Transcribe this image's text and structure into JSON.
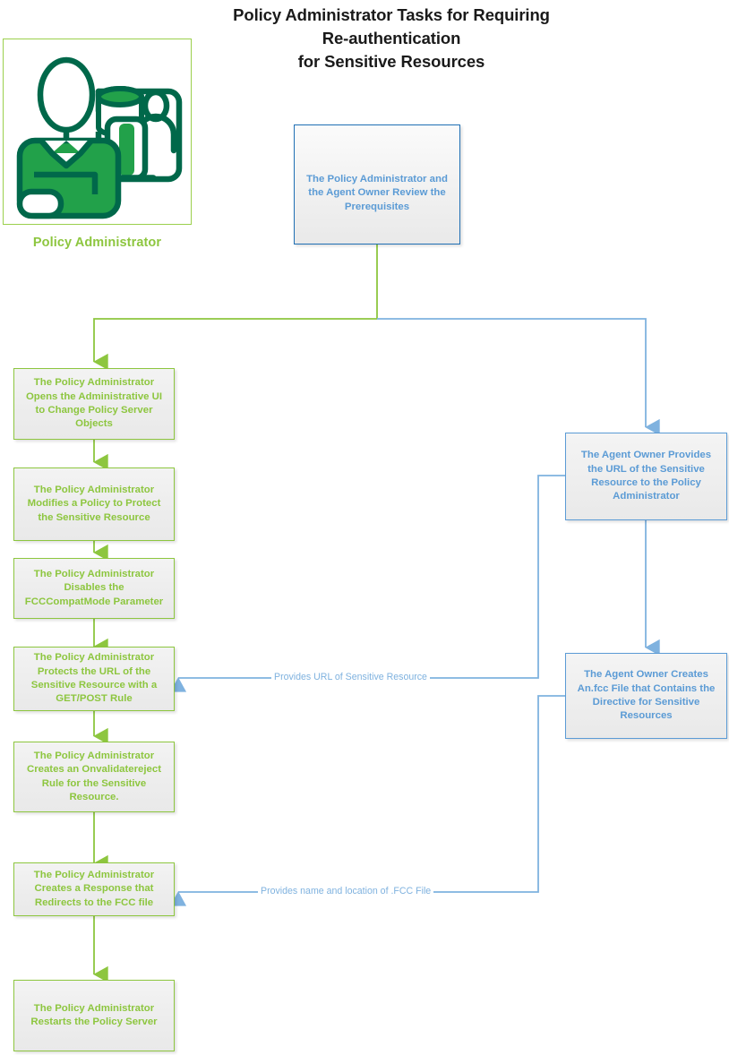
{
  "title": {
    "line1": "Policy Administrator Tasks for Requiring",
    "line2": "Re-authentication",
    "line3": "for Sensitive Resources"
  },
  "actor": {
    "label": "Policy Administrator",
    "icon": "policy-administrator-icon"
  },
  "colors": {
    "green": "#8DC63F",
    "green_border": "#8DC63F",
    "blue": "#5B9BD5",
    "blue_dark": "#1F6FB4",
    "node_fill": "#EDEDED",
    "title": "#1A1A1A"
  },
  "nodes": {
    "start": {
      "id": "review-prerequisites",
      "text": "The Policy Administrator and the Agent Owner Review the Prerequisites",
      "style": "blue-dark"
    },
    "admin": [
      {
        "id": "open-admin-ui",
        "text": "The Policy Administrator Opens the Administrative UI to Change Policy Server Objects",
        "style": "green"
      },
      {
        "id": "modify-policy",
        "text": "The Policy Administrator Modifies a Policy to Protect the Sensitive Resource",
        "style": "green"
      },
      {
        "id": "disable-fcccompatmode",
        "text": "The Policy Administrator Disables the FCCCompatMode Parameter",
        "style": "green"
      },
      {
        "id": "protect-url-get-post",
        "text": "The Policy Administrator Protects the URL of the Sensitive Resource with a GET/POST Rule",
        "style": "green"
      },
      {
        "id": "create-onvalidatereject-rule",
        "text": "The Policy Administrator Creates an Onvalidatereject Rule for the Sensitive Resource.",
        "style": "green"
      },
      {
        "id": "create-redirect-response",
        "text": "The Policy Administrator Creates a Response that Redirects to the FCC file",
        "style": "green"
      },
      {
        "id": "restart-policy-server",
        "text": "The Policy Administrator Restarts the Policy Server",
        "style": "green"
      }
    ],
    "owner": [
      {
        "id": "provide-url",
        "text": "The Agent Owner Provides the URL of the Sensitive Resource to the Policy Administrator",
        "style": "blue"
      },
      {
        "id": "create-fcc-file",
        "text": "The Agent Owner Creates An.fcc File that Contains the Directive for Sensitive Resources",
        "style": "blue"
      }
    ]
  },
  "connector_labels": {
    "provides_url": "Provides URL of Sensitive Resource",
    "provides_fcc": "Provides name and location of .FCC File"
  }
}
